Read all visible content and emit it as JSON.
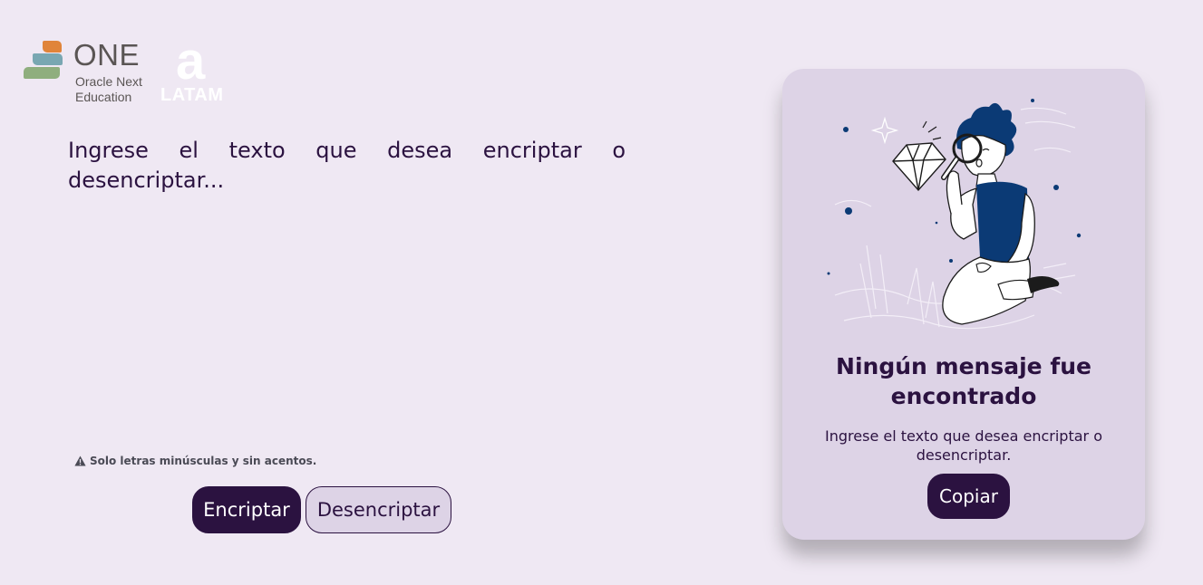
{
  "header": {
    "one_logo": {
      "title": "ONE",
      "subtitle_line1": "Oracle Next",
      "subtitle_line2": "Education"
    },
    "alura_logo": {
      "mark": "a",
      "word": "LATAM"
    }
  },
  "input": {
    "placeholder": "Ingrese el texto que desea encriptar o desencriptar...",
    "value": ""
  },
  "hint": {
    "icon": "warning-icon",
    "text": "Solo letras minúsculas y sin acentos."
  },
  "buttons": {
    "encrypt": "Encriptar",
    "decrypt": "Desencriptar"
  },
  "result_panel": {
    "title": "Ningún mensaje fue encontrado",
    "message": "Ingrese el texto que desea encriptar o desencriptar.",
    "copy_button": "Copiar",
    "illustration": "person-with-magnifying-glass-diamond"
  },
  "colors": {
    "background": "#efe8f3",
    "primary": "#2b1240",
    "card": "#ddd3e6",
    "accent_blue": "#0b3a75"
  }
}
